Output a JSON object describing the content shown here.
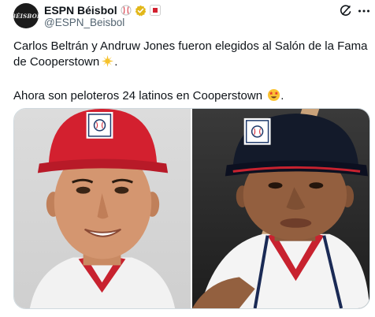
{
  "account": {
    "display_name": "ESPN Béisbol",
    "handle": "@ESPN_Beisbol",
    "avatar_text": "BÉISBOL"
  },
  "tweet": {
    "line1": "Carlos Beltrán y Andruw Jones fueron elegidos al Salón de la Fama de Cooperstown",
    "line2": "Ahora son peloteros 24 latinos en Cooperstown",
    "emoji1": "sparkles-emoji",
    "emoji2": "star-struck-emoji",
    "period": "."
  },
  "media": {
    "photos": [
      {
        "icon": "player-photo-left"
      },
      {
        "icon": "player-photo-right"
      }
    ]
  },
  "colors": {
    "verified_badge": "#e2b719",
    "text_primary": "#0f1419",
    "text_secondary": "#536471",
    "cap_red": "#d3202f",
    "cap_navy": "#131a2a"
  }
}
